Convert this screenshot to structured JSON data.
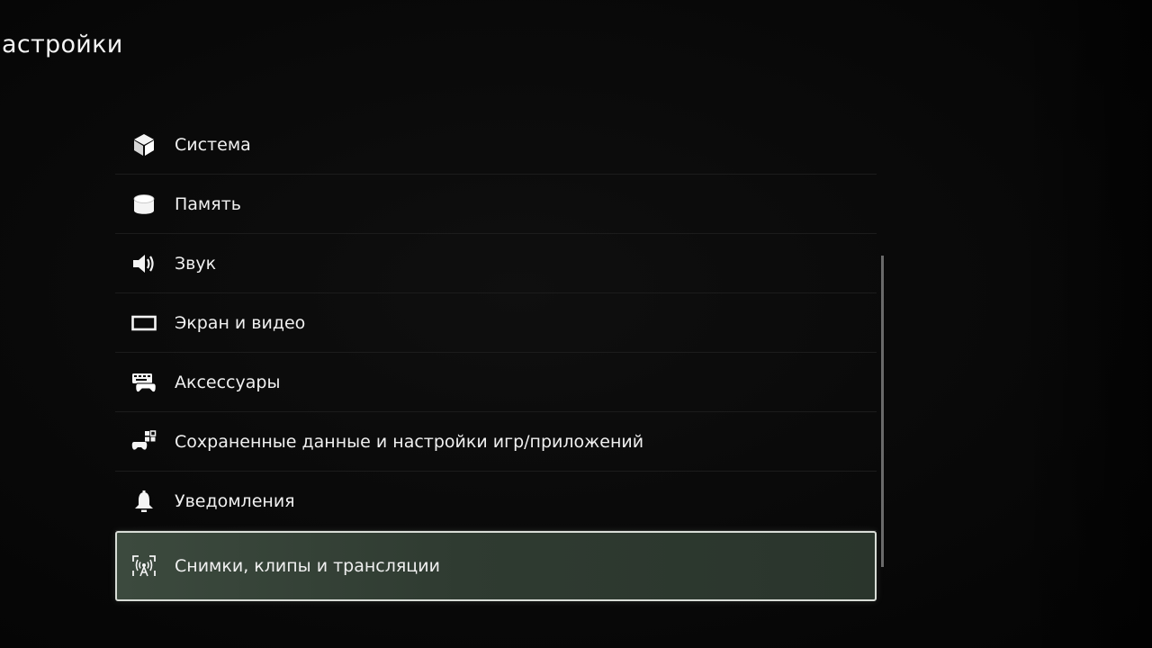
{
  "page": {
    "title": "астройки"
  },
  "menu": {
    "items": [
      {
        "label": "Система",
        "icon": "cube-icon"
      },
      {
        "label": "Память",
        "icon": "storage-cylinder-icon"
      },
      {
        "label": "Звук",
        "icon": "speaker-icon"
      },
      {
        "label": "Экран и видео",
        "icon": "display-icon"
      },
      {
        "label": "Аксессуары",
        "icon": "keyboard-gamepad-icon"
      },
      {
        "label": "Сохраненные данные и настройки игр/приложений",
        "icon": "gamepad-grid-icon"
      },
      {
        "label": "Уведомления",
        "icon": "bell-icon"
      },
      {
        "label": "Снимки, клипы и трансляции",
        "icon": "capture-broadcast-icon"
      }
    ],
    "selected_index": 7
  },
  "colors": {
    "background": "#060606",
    "text": "#f0f0f0",
    "selection_fill": "#34423a",
    "selection_border": "#d8dcd6"
  }
}
